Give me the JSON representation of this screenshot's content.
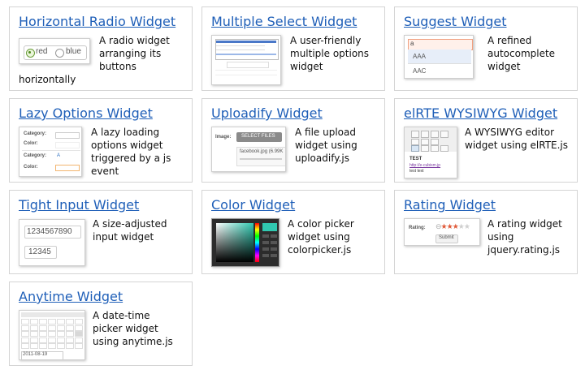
{
  "widgets": [
    {
      "title": "Horizontal Radio Widget",
      "desc": "A radio widget arranging its buttons",
      "desc_more": "horizontally",
      "thumb": {
        "radio_red": "red",
        "radio_blue": "blue"
      }
    },
    {
      "title": "Multiple Select Widget",
      "desc": "A user-friendly multiple options widget"
    },
    {
      "title": "Suggest Widget",
      "desc": "A refined autocomplete widget",
      "thumb": {
        "input": "a",
        "opt1": "AAA",
        "opt2": "AAC"
      }
    },
    {
      "title": "Lazy Options Widget",
      "desc": "A lazy loading options widget triggered by a js event",
      "thumb": {
        "l1": "Category:",
        "l2": "Color:",
        "l3": "Category:",
        "l4": "Color:",
        "v1": "A"
      }
    },
    {
      "title": "Uploadify Widget",
      "desc": "A file upload widget using uploadify.js",
      "thumb": {
        "label": "Image:",
        "button": "SELECT FILES",
        "file": "facebook.jpg (6.99K"
      }
    },
    {
      "title": "elRTE WYSIWYG Widget",
      "desc": "A WYSIWYG editor widget using elRTE.js",
      "thumb": {
        "t1": "TEST",
        "t2": "http://e-cubism.jp",
        "t3": "test text"
      }
    },
    {
      "title": "Tight Input Widget",
      "desc": "A size-adjusted input widget",
      "thumb": {
        "v1": "1234567890",
        "v2": "12345"
      }
    },
    {
      "title": "Color Widget",
      "desc": "A color picker widget using colorpicker.js"
    },
    {
      "title": "Rating Widget",
      "desc": "A rating widget using jquery.rating.js",
      "thumb": {
        "label": "Rating:",
        "button": "Submit",
        "rating": 3,
        "max": 5
      }
    },
    {
      "title": "Anytime Widget",
      "desc": "A date-time picker widget using anytime.js",
      "thumb": {
        "date": "2011-08-19"
      }
    }
  ]
}
